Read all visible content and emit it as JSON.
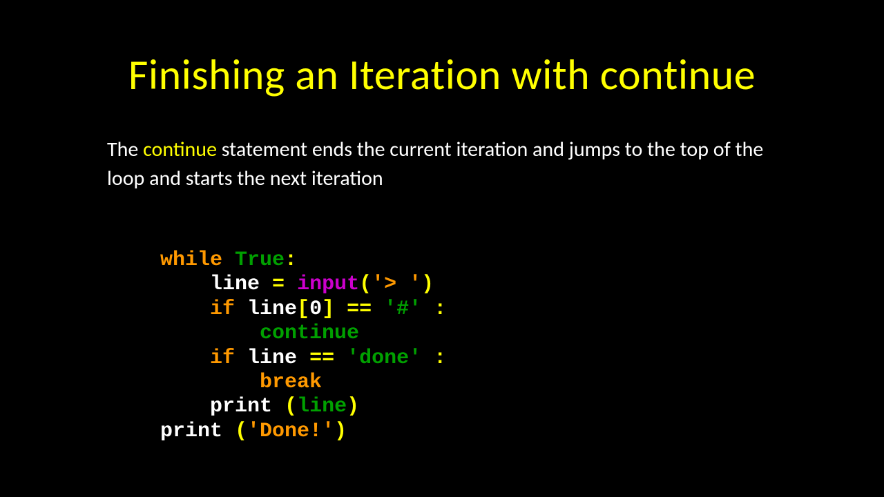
{
  "title": "Finishing an Iteration with continue",
  "body": {
    "pre": "The ",
    "kw": "continue",
    "post": " statement ends the current iteration and jumps to the top of the loop and starts the next iteration"
  },
  "code": {
    "l1": {
      "while": "while",
      "sp1": " ",
      "true": "True",
      "colon": ":"
    },
    "l2": {
      "indent": "    ",
      "line": "line",
      "sp1": " ",
      "eq": "=",
      "sp2": " ",
      "input": "input",
      "lp": "(",
      "str": "'> '",
      "rp": ")"
    },
    "l3": {
      "indent": "    ",
      "if": "if",
      "sp1": " ",
      "line": "line",
      "lb": "[",
      "idx": "0",
      "rb": "]",
      "sp2": " ",
      "cmp": "==",
      "sp3": " ",
      "str": "'#'",
      "sp4": " ",
      "colon": ":"
    },
    "l4": {
      "indent": "        ",
      "continue": "continue"
    },
    "l5": {
      "indent": "    ",
      "if": "if",
      "sp1": " ",
      "line": "line",
      "sp2": " ",
      "cmp": "==",
      "sp3": " ",
      "str": "'done'",
      "sp4": " ",
      "colon": ":"
    },
    "l6": {
      "indent": "        ",
      "break": "break"
    },
    "l7": {
      "indent": "    ",
      "print": "print",
      "sp1": " ",
      "lp": "(",
      "arg": "line",
      "rp": ")"
    },
    "l8": {
      "print": "print",
      "sp1": " ",
      "lp": "(",
      "str": "'Done!'",
      "rp": ")"
    }
  }
}
